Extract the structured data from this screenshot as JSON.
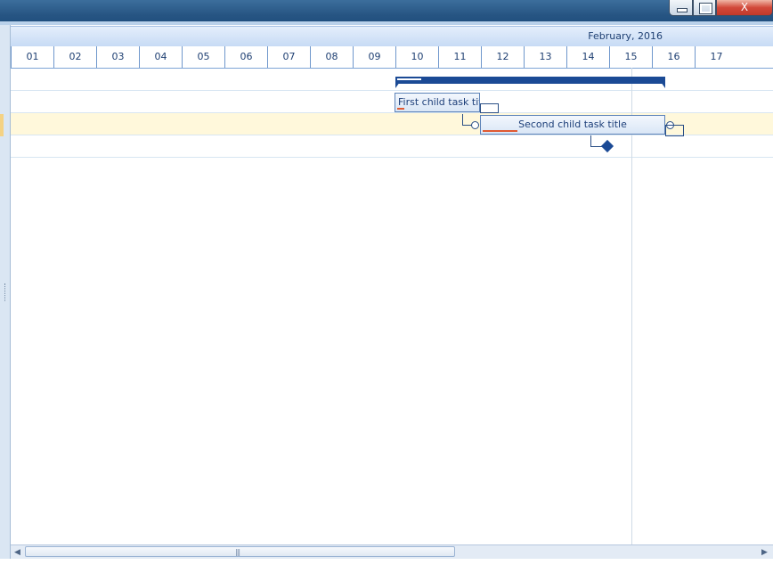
{
  "window": {
    "minimize_icon": "minimize-icon",
    "maximize_icon": "maximize-icon",
    "close_glyph": "X"
  },
  "timeline": {
    "month_label": "February, 2016",
    "days": [
      "01",
      "02",
      "03",
      "04",
      "05",
      "06",
      "07",
      "08",
      "09",
      "10",
      "11",
      "12",
      "13",
      "14",
      "15",
      "16",
      "17"
    ]
  },
  "tasks": {
    "first_child": "First child task titl",
    "second_child": "Second child task title"
  },
  "colors": {
    "summary_bar": "#1b4a95",
    "progress": "#e05a32",
    "selected_row": "#fff8db"
  },
  "scrollbar": {
    "left_arrow": "◀",
    "right_arrow": "▶",
    "thumb_grip": "|||"
  }
}
